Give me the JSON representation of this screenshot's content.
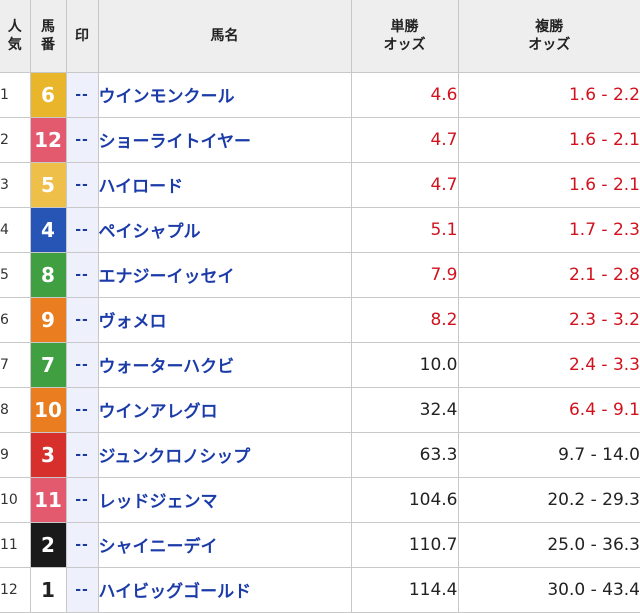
{
  "headers": {
    "popularity": [
      "人",
      "気"
    ],
    "horse_number": [
      "馬",
      "番"
    ],
    "mark": "印",
    "horse_name": "馬名",
    "win_odds": [
      "単勝",
      "オッズ"
    ],
    "place_odds": [
      "複勝",
      "オッズ"
    ]
  },
  "colors": {
    "header_bg": "#eeeeee",
    "horse_name": "#1b3ba8",
    "odds_low": "#d1121e",
    "odds_high": "#222222",
    "mark_bg": "#eef1fb"
  },
  "rows": [
    {
      "rank": "1",
      "number": "6",
      "bg": "#e8b52b",
      "fg": "#ffffff",
      "mark": "--",
      "name": "ウインモンクール",
      "win": "4.6",
      "place": "1.6 - 2.2",
      "win_red": true,
      "place_red": true
    },
    {
      "rank": "2",
      "number": "12",
      "bg": "#e35a6f",
      "fg": "#ffffff",
      "mark": "--",
      "name": "ショーライトイヤー",
      "win": "4.7",
      "place": "1.6 - 2.1",
      "win_red": true,
      "place_red": true
    },
    {
      "rank": "3",
      "number": "5",
      "bg": "#eec04a",
      "fg": "#ffffff",
      "mark": "--",
      "name": "ハイロード",
      "win": "4.7",
      "place": "1.6 - 2.1",
      "win_red": true,
      "place_red": true
    },
    {
      "rank": "4",
      "number": "4",
      "bg": "#2655b5",
      "fg": "#ffffff",
      "mark": "--",
      "name": "ペイシャプル",
      "win": "5.1",
      "place": "1.7 - 2.3",
      "win_red": true,
      "place_red": true
    },
    {
      "rank": "5",
      "number": "8",
      "bg": "#3f9f41",
      "fg": "#ffffff",
      "mark": "--",
      "name": "エナジーイッセイ",
      "win": "7.9",
      "place": "2.1 - 2.8",
      "win_red": true,
      "place_red": true
    },
    {
      "rank": "6",
      "number": "9",
      "bg": "#ea7d1f",
      "fg": "#ffffff",
      "mark": "--",
      "name": "ヴォメロ",
      "win": "8.2",
      "place": "2.3 - 3.2",
      "win_red": true,
      "place_red": true
    },
    {
      "rank": "7",
      "number": "7",
      "bg": "#3f9f41",
      "fg": "#ffffff",
      "mark": "--",
      "name": "ウォーターハクビ",
      "win": "10.0",
      "place": "2.4 - 3.3",
      "win_red": false,
      "place_red": true
    },
    {
      "rank": "8",
      "number": "10",
      "bg": "#ea7d1f",
      "fg": "#ffffff",
      "mark": "--",
      "name": "ウインアレグロ",
      "win": "32.4",
      "place": "6.4 - 9.1",
      "win_red": false,
      "place_red": true
    },
    {
      "rank": "9",
      "number": "3",
      "bg": "#d7302c",
      "fg": "#ffffff",
      "mark": "--",
      "name": "ジュンクロノシップ",
      "win": "63.3",
      "place": "9.7 - 14.0",
      "win_red": false,
      "place_red": false
    },
    {
      "rank": "10",
      "number": "11",
      "bg": "#e35a6f",
      "fg": "#ffffff",
      "mark": "--",
      "name": "レッドジェンマ",
      "win": "104.6",
      "place": "20.2 - 29.3",
      "win_red": false,
      "place_red": false
    },
    {
      "rank": "11",
      "number": "2",
      "bg": "#1a1a1a",
      "fg": "#ffffff",
      "mark": "--",
      "name": "シャイニーデイ",
      "win": "110.7",
      "place": "25.0 - 36.3",
      "win_red": false,
      "place_red": false
    },
    {
      "rank": "12",
      "number": "1",
      "bg": "#ffffff",
      "fg": "#222222",
      "mark": "--",
      "name": "ハイビッグゴールド",
      "win": "114.4",
      "place": "30.0 - 43.4",
      "win_red": false,
      "place_red": false
    }
  ]
}
